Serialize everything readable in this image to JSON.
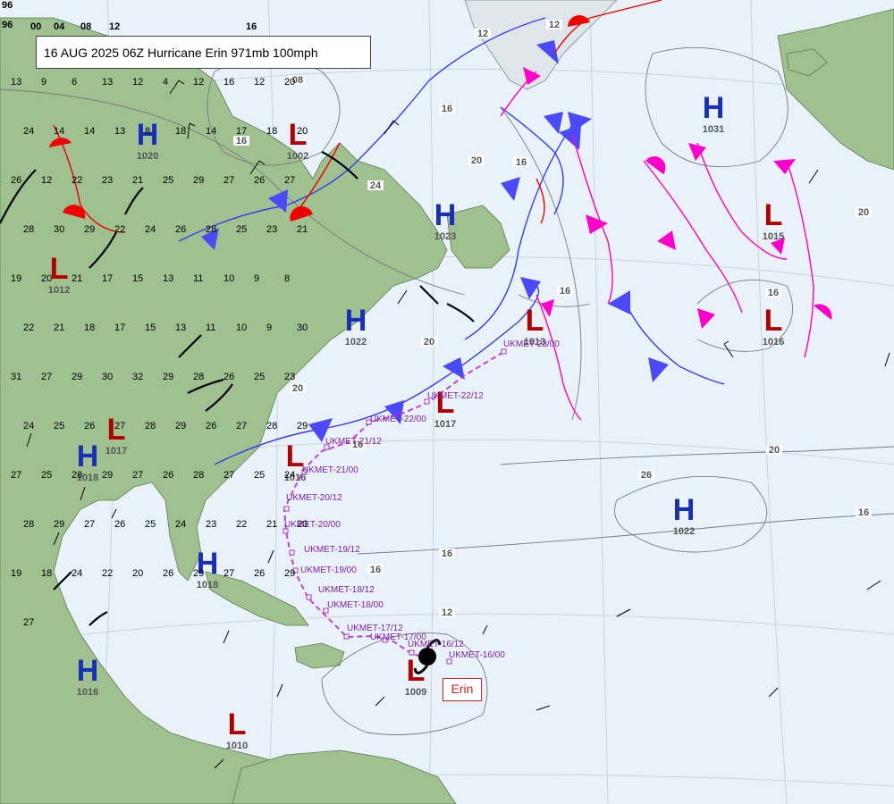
{
  "header": {
    "title": "16 AUG 2025 06Z Hurricane Erin 971mb 100mph",
    "storm_label": "Erin"
  },
  "colors": {
    "ocean": "#e8f2f8",
    "land": "#9fc08f",
    "high": "#1a2fb8",
    "low": "#b00000",
    "cold_front": "#3a3af0",
    "warm_front": "#f00000",
    "trough": "#ff00cc",
    "track": "#c040e0",
    "isobar": "#7a7a7a"
  },
  "pressure_centers": [
    {
      "type": "H",
      "value": "1020"
    },
    {
      "type": "L",
      "value": "1002"
    },
    {
      "type": "H",
      "value": "1023"
    },
    {
      "type": "H",
      "value": "1031"
    },
    {
      "type": "L",
      "value": "1015"
    },
    {
      "type": "L",
      "value": "1012"
    },
    {
      "type": "H",
      "value": "1022"
    },
    {
      "type": "L",
      "value": "1013"
    },
    {
      "type": "L",
      "value": "1016"
    },
    {
      "type": "L",
      "value": "1017"
    },
    {
      "type": "L",
      "value": "1017"
    },
    {
      "type": "L",
      "value": "1016"
    },
    {
      "type": "H",
      "value": "1018"
    },
    {
      "type": "H",
      "value": "1022"
    },
    {
      "type": "H",
      "value": "1018"
    },
    {
      "type": "H",
      "value": "1016"
    },
    {
      "type": "L",
      "value": "1010"
    },
    {
      "type": "L",
      "value": "1009"
    }
  ],
  "track_points": [
    "UKMET-16/00",
    "UKMET-16/12",
    "UKMET-17/00",
    "UKMET-17/12",
    "UKMET-18/00",
    "UKMET-18/12",
    "UKMET-19/00",
    "UKMET-19/12",
    "UKMET-20/00",
    "UKMET-20/12",
    "UKMET-21/00",
    "UKMET-21/12",
    "UKMET-22/00",
    "UKMET-22/12",
    "UKMET-23/00"
  ],
  "isobar_labels": [
    "08",
    "16",
    "20",
    "16",
    "20",
    "16",
    "16",
    "20",
    "26",
    "12",
    "16",
    "24",
    "20",
    "16",
    "12",
    "16",
    "16",
    "16",
    "20",
    "12"
  ],
  "top_strip_labels": [
    "96",
    "96",
    "00",
    "04",
    "08",
    "12",
    "16"
  ],
  "station_values": [
    "13",
    "9",
    "6",
    "13",
    "12",
    "4",
    "12",
    "16",
    "12",
    "20",
    "24",
    "14",
    "14",
    "13",
    "8",
    "18",
    "14",
    "17",
    "18",
    "20",
    "26",
    "12",
    "22",
    "23",
    "21",
    "25",
    "29",
    "27",
    "26",
    "27",
    "28",
    "30",
    "29",
    "22",
    "24",
    "26",
    "28",
    "25",
    "23",
    "21",
    "19",
    "20",
    "21",
    "17",
    "15",
    "13",
    "11",
    "10",
    "9",
    "8",
    "22",
    "21",
    "18",
    "17",
    "15",
    "13",
    "11",
    "10",
    "9",
    "30",
    "31",
    "27",
    "29",
    "30",
    "32",
    "29",
    "28",
    "26",
    "25",
    "23",
    "24",
    "25",
    "26",
    "27",
    "28",
    "29",
    "26",
    "27",
    "28",
    "29",
    "27",
    "25",
    "28",
    "29",
    "27",
    "26",
    "28",
    "27",
    "25",
    "24",
    "28",
    "29",
    "27",
    "26",
    "25",
    "24",
    "23",
    "22",
    "21",
    "20",
    "19",
    "18",
    "24",
    "22",
    "20",
    "26",
    "29",
    "27",
    "26",
    "29",
    "27"
  ]
}
